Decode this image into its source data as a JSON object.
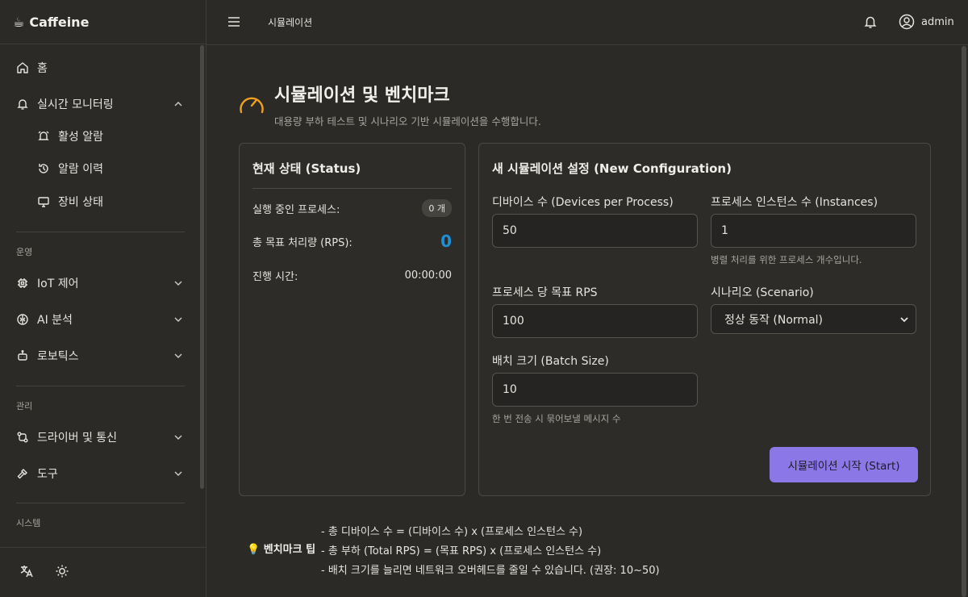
{
  "brand": {
    "name": "Caffeine",
    "icon": "coffee-icon"
  },
  "sidebar": {
    "home": "홈",
    "monitoring": "실시간 모니터링",
    "monitoring_children": [
      "활성 알람",
      "알람 이력",
      "장비 상태"
    ],
    "section_operation": "운영",
    "iot": "IoT 제어",
    "ai": "AI 분석",
    "robotics": "로보틱스",
    "section_manage": "관리",
    "drivers": "드라이버 및 통신",
    "tools": "도구",
    "section_system": "시스템"
  },
  "topbar": {
    "breadcrumb": "시뮬레이션",
    "user": "admin"
  },
  "page": {
    "title": "시뮬레이션 및 벤치마크",
    "subtitle": "대용량 부하 테스트 및 시나리오 기반 시뮬레이션을 수행합니다."
  },
  "status": {
    "title": "현재 상태 (Status)",
    "running_label": "실행 중인 프로세스:",
    "running_value": "0 개",
    "rps_label": "총 목표 처리량 (RPS):",
    "rps_value": "0",
    "elapsed_label": "진행 시간:",
    "elapsed_value": "00:00:00"
  },
  "config": {
    "title": "새 시뮬레이션 설정 (New Configuration)",
    "devices_label": "디바이스 수 (Devices per Process)",
    "devices_value": "50",
    "instances_label": "프로세스 인스턴스 수 (Instances)",
    "instances_value": "1",
    "instances_hint": "병렬 처리를 위한 프로세스 개수입니다.",
    "rps_label": "프로세스 당 목표 RPS",
    "rps_value": "100",
    "scenario_label": "시나리오 (Scenario)",
    "scenario_value": "정상 동작 (Normal)",
    "batch_label": "배치 크기 (Batch Size)",
    "batch_value": "10",
    "batch_hint": "한 번 전송 시 묶어보낼 메시지 수",
    "start_button": "시뮬레이션 시작 (Start)"
  },
  "tips": {
    "title": "💡 벤치마크 팁",
    "lines": [
      "- 총 디바이스 수 = (디바이스 수) x (프로세스 인스턴스 수)",
      "- 총 부하 (Total RPS) = (목표 RPS) x (프로세스 인스턴스 수)",
      "- 배치 크기를 늘리면 네트워크 오버헤드를 줄일 수 있습니다. (권장: 10~50)"
    ]
  },
  "colors": {
    "accent": "#8b78e6",
    "rps": "#1e90d8",
    "gauge": "#f0a020",
    "background": "#2b2a27"
  }
}
